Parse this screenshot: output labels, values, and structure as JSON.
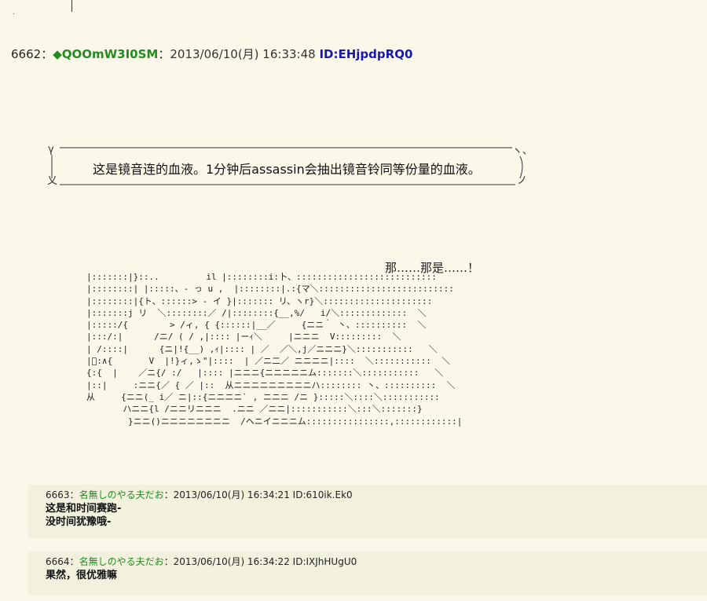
{
  "main_post": {
    "number": "6662",
    "sep": "：",
    "trip": "◆QOOmW3I0SM",
    "sep2": "：",
    "date": "2013/06/10(月) 16:33:48",
    "id": "ID:EHjpdpRQ0"
  },
  "bubble": {
    "text": "这是镜音连的血液。1分钟后assassin会抽出镜音铃同等份量的血液。",
    "corner_tl": "γ",
    "corner_bl": "乂",
    "corner_tr": "ヽ、",
    "corner_br": "ノ"
  },
  "exclaim": "那……那是……！",
  "ascii_art": "|:::::::|}::..         il |::::::::i:卜、:::::::::::::::::::::::::::\n|::::::::| |:::::、- っ u ,  |::::::::|.:{マ＼::::::::::::::::::::::::::\n|::::::::|{ト、::::::> ‐ イ }|::::::: リ、ヽr}＼:::::::::::::::::::::\n|:::::::j リ  ＼::::::::／ /|::::::::{__,%/   i/＼:::::::::::::  ＼\n|:::::/{        > /ィ, { {::::::|__／     {ニニ｀ 丶、::::::::::  ＼\n|:::/:|      /ニ/ ( / ,|:::: |ーｨ＼     |ニニニ  V:::::::::  ＼\n| /::::|      {ニ|!{__) ,ｨ|:::: | ／  ／＼,j／ニニニ}＼:::::::::::   ＼\n|ﾞ:∧{       V  |!}ィ,ゝ\"|::::  | ／ニ二／ ニニニニ|::::  ＼:::::::::::  ＼\n{:{  |    ／ニ{/ :/   |:::: |ニニニ{ニニニニニム:::::::＼:::::::::::   ＼\n|::|     :ニニ{／ { ／ |::  从ニニニニニニニニニハ:::::::: 丶、::::::::::  ＼\n从     {ニニ(_ i／ ニ|::{ニニニニ` , ニニニ /ニ }:::::＼::::＼:::::::::::\n       ハニニ{l /ニニリニニニ  .ニニ ／ニニ|:::::::::::＼:::＼:::::::}\n        }ニニ()ニニニニニニニニ  /ヘニイニニニム::::::::::::::::,::::::::::::|",
  "replies": [
    {
      "number": "6663",
      "sep": "：",
      "name": "名無しのやる夫だお",
      "sep2": "：",
      "date": "2013/06/10(月) 16:34:21",
      "id": "ID:610ik.Ek0",
      "body": "这是和时间赛跑-\n没时间犹豫哦-"
    },
    {
      "number": "6664",
      "sep": "：",
      "name": "名無しのやる夫だお",
      "sep2": "：",
      "date": "2013/06/10(月) 16:34:22",
      "id": "ID:IXJhHUgU0",
      "body": "果然，很优雅嘛"
    }
  ],
  "colors": {
    "background": "#fbf8ea",
    "reply_background": "#f2f1dd",
    "name_green": "#228b22",
    "id_blue": "#1a1aa6"
  }
}
